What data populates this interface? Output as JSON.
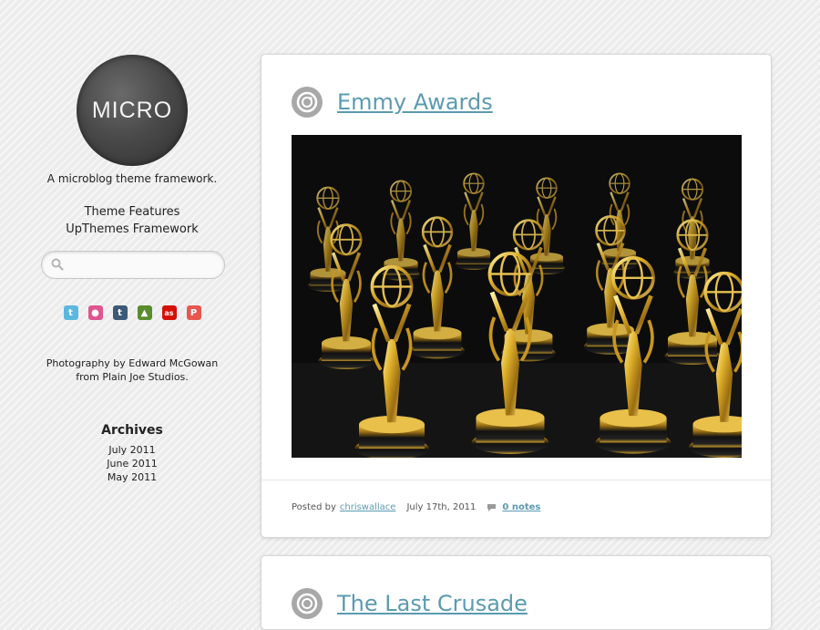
{
  "sidebar": {
    "logo_text": "MICRO",
    "tagline": "A microblog theme framework.",
    "nav": [
      {
        "label": "Theme Features"
      },
      {
        "label": "UpThemes Framework"
      }
    ],
    "search": {
      "placeholder": "",
      "value": ""
    },
    "social_icons": [
      {
        "name": "twitter-icon",
        "glyph": "t",
        "color": "#5bb7e0"
      },
      {
        "name": "dribbble-icon",
        "glyph": "●",
        "color": "#e0558f"
      },
      {
        "name": "tumblr-icon",
        "glyph": "t",
        "color": "#3c5a78"
      },
      {
        "name": "forrst-icon",
        "glyph": "▲",
        "color": "#5a8c2d"
      },
      {
        "name": "lastfm-icon",
        "glyph": "as",
        "color": "#d51007"
      },
      {
        "name": "posterous-icon",
        "glyph": "P",
        "color": "#e8564e"
      }
    ],
    "credit_line1": "Photography by Edward McGowan",
    "credit_line2": "from Plain Joe Studios.",
    "archives": {
      "title": "Archives",
      "items": [
        {
          "label": "July 2011"
        },
        {
          "label": "June 2011"
        },
        {
          "label": "May 2011"
        }
      ]
    }
  },
  "posts": [
    {
      "title": "Emmy Awards",
      "image_alt": "Rows of golden Emmy award statuettes",
      "posted_by_label": "Posted by",
      "author": "chriswallace",
      "date": "July 17th, 2011",
      "notes": "0 notes"
    },
    {
      "title": "The Last Crusade"
    }
  ],
  "colors": {
    "accent": "#5b9bb0",
    "background": "#ececec"
  }
}
